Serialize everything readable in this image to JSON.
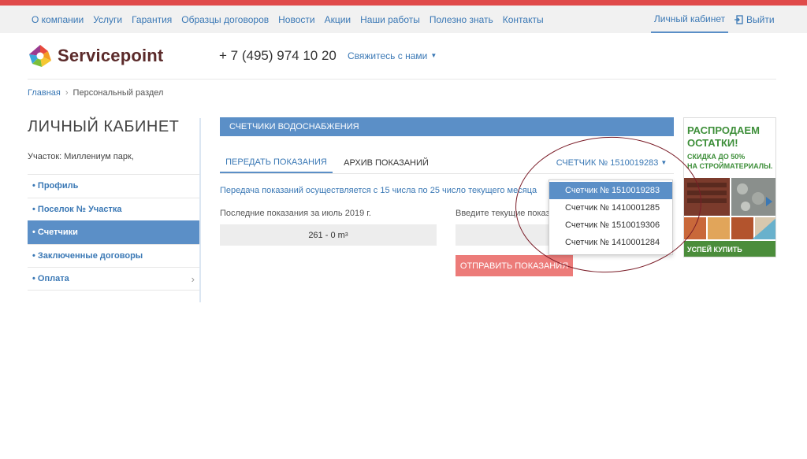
{
  "topnav": {
    "items": [
      "О компании",
      "Услуги",
      "Гарантия",
      "Образцы договоров",
      "Новости",
      "Акции",
      "Наши работы",
      "Полезно знать",
      "Контакты"
    ],
    "account": "Личный кабинет",
    "logout": "Выйти"
  },
  "header": {
    "logo_text": "Servicepoint",
    "phone": "+ 7 (495) 974 10 20",
    "contact": "Свяжитесь с нами"
  },
  "breadcrumb": {
    "home": "Главная",
    "current": "Персональный раздел"
  },
  "sidebar": {
    "title": "ЛИЧНЫЙ КАБИНЕТ",
    "plot": "Участок: Миллениум парк,",
    "items": [
      {
        "label": "• Профиль"
      },
      {
        "label": "• Поселок № Участка"
      },
      {
        "label": "• Счетчики"
      },
      {
        "label": "• Заключенные договоры"
      },
      {
        "label": "• Оплата"
      }
    ]
  },
  "main": {
    "section_title": "СЧЕТЧИКИ ВОДОСНАБЖЕНИЯ",
    "tabs": [
      {
        "label": "ПЕРЕДАТЬ ПОКАЗАНИЯ"
      },
      {
        "label": "АРХИВ ПОКАЗАНИЙ"
      }
    ],
    "meter_select": "СЧЕТЧИК № 1510019283",
    "info": "Передача показаний осуществляется с 15 числа по 25 число текущего месяца",
    "last_label": "Последние показания за июль 2019 г.",
    "last_value": "261 - 0 m",
    "last_unit_sup": "3",
    "current_label": "Введите текущие показ",
    "submit": "ОТПРАВИТЬ ПОКАЗАНИЯ"
  },
  "dropdown": {
    "options": [
      "Счетчик № 1510019283",
      "Счетчик № 1410001285",
      "Счетчик № 1510019306",
      "Счетчик № 1410001284"
    ],
    "selected_index": 0
  },
  "ad": {
    "headline_1": "РАСПРОДАЕМ",
    "headline_2": "ОСТАТКИ!",
    "sub_1": "СКИДКА ДО 50%",
    "sub_2": "НА СТРОЙМАТЕРИАЛЫ.",
    "footer": "УСПЕЙ КУПИТЬ"
  },
  "colors": {
    "accent_blue": "#5b8fc7",
    "link_blue": "#3a78b5",
    "top_red": "#e04a4a",
    "button_red": "#ec7b79",
    "ad_green": "#3e8f3a",
    "annotation_circle": "#7a1c27"
  }
}
